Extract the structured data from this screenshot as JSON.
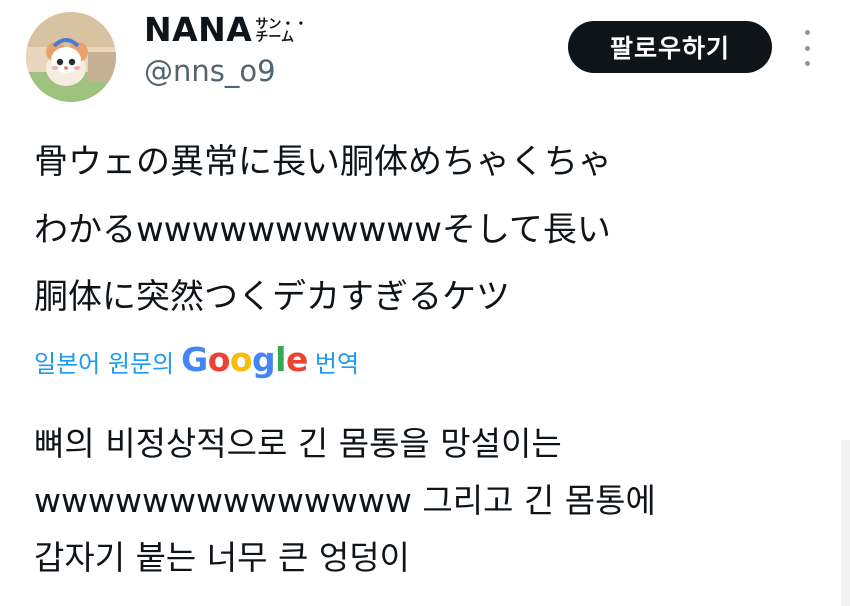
{
  "author": {
    "display_name": "NANA",
    "name_suffix_top": "サン・・",
    "name_suffix_bottom": "チーム",
    "handle": "@nns_o9"
  },
  "follow_button_label": "팔로우하기",
  "more_icon": "more-vertical-icon",
  "tweet": {
    "lines": [
      "骨ウェの異常に長い胴体めちゃくちゃ",
      "わかるwwwwwwwwwwwそして長い",
      "胴体に突然つくデカすぎるケツ"
    ]
  },
  "translation_bar": {
    "prefix": "일본어 원문의",
    "brand": "Google",
    "suffix": "번역"
  },
  "translated": {
    "lines": [
      "뼈의 비정상적으로 긴 몸통을 망설이는",
      "wwwwwwwwwwwwww 그리고 긴 몸통에",
      "갑자기 붙는 너무 큰 엉덩이"
    ]
  },
  "colors": {
    "link_blue": "#1d9bf0",
    "button_bg": "#0f1419",
    "handle_gray": "#536471"
  }
}
